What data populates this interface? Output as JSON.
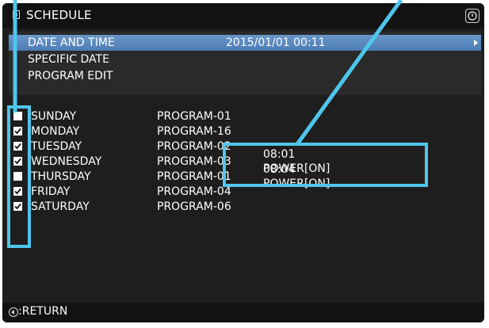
{
  "title": "SCHEDULE",
  "menu": [
    {
      "label": "DATE AND TIME",
      "value": "2015/01/01 00:11",
      "selected": true
    },
    {
      "label": "SPECIFIC DATE"
    },
    {
      "label": "PROGRAM EDIT"
    }
  ],
  "days": [
    {
      "day": "SUNDAY",
      "program": "PROGRAM-01",
      "checked": false
    },
    {
      "day": "MONDAY",
      "program": "PROGRAM-16",
      "checked": true
    },
    {
      "day": "TUESDAY",
      "program": "PROGRAM-02",
      "checked": true
    },
    {
      "day": "WEDNESDAY",
      "program": "PROGRAM-03",
      "checked": true
    },
    {
      "day": "THURSDAY",
      "program": "PROGRAM-01",
      "checked": false
    },
    {
      "day": "FRIDAY",
      "program": "PROGRAM-04",
      "checked": true
    },
    {
      "day": "SATURDAY",
      "program": "PROGRAM-06",
      "checked": true
    }
  ],
  "events": [
    "08:01 POWER[ON]",
    "08:04 POWER[ON]"
  ],
  "footer": {
    "return_label": ":RETURN"
  },
  "colors": {
    "callout": "#4fc6ec",
    "selected_row": "#5b8ac2",
    "background": "#1e1e1e"
  },
  "icons": {
    "title": "schedule-icon",
    "help": "help-icon",
    "return": "return-icon"
  }
}
